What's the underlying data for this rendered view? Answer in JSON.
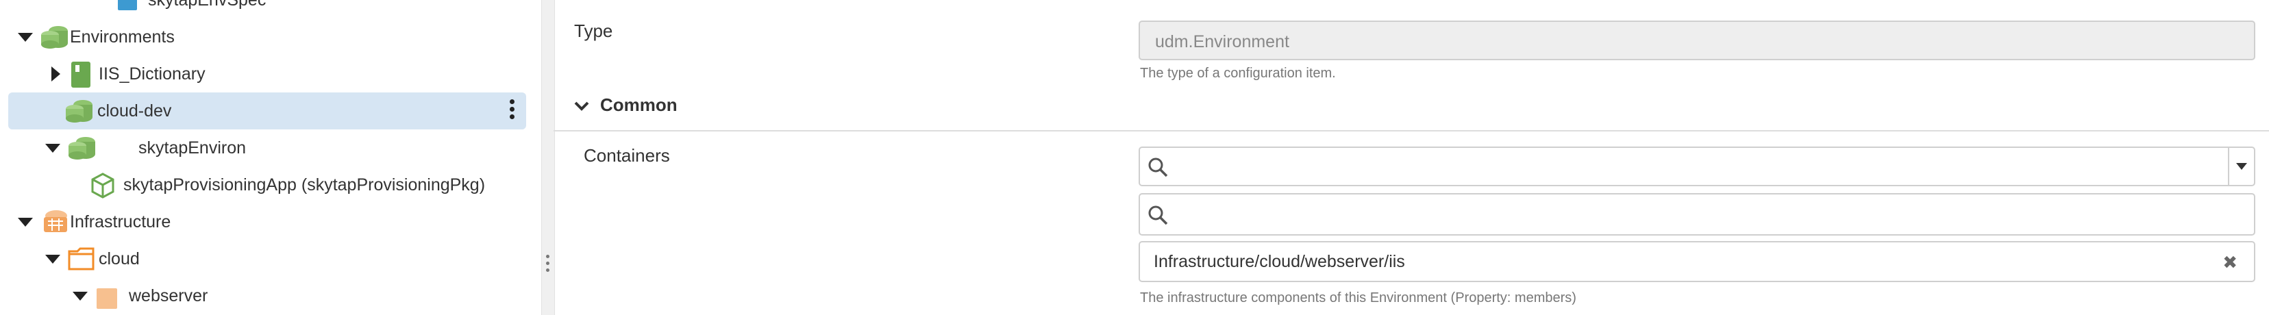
{
  "tree": {
    "items": [
      {
        "label": "skytapEnvSpec"
      },
      {
        "label": "Environments"
      },
      {
        "label": "IIS_Dictionary"
      },
      {
        "label": "cloud-dev"
      },
      {
        "label": "skytapEnviron"
      },
      {
        "label": "skytapProvisioningApp (skytapProvisioningPkg)"
      },
      {
        "label": "Infrastructure"
      },
      {
        "label": "cloud"
      },
      {
        "label": "webserver"
      }
    ]
  },
  "form": {
    "type_label": "Type",
    "type_value": "udm.Environment",
    "type_help": "The type of a configuration item.",
    "section_title": "Common",
    "containers_label": "Containers",
    "containers_help": "The infrastructure components of this Environment (Property: members)",
    "member_item": "Infrastructure/cloud/webserver/iis",
    "remove_glyph": "✖"
  },
  "colors": {
    "selected_row": "#d6e5f3",
    "env_icon": "#79b05a",
    "infra_icon": "#f2a25c",
    "folder_icon": "#f28c28",
    "dictionary_icon": "#6aa84f",
    "spec_icon": "#3d9ad1"
  }
}
